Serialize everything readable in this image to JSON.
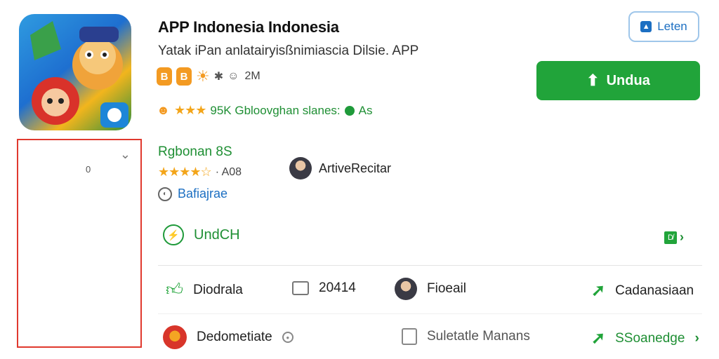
{
  "app": {
    "title": "APP Indonesia Indonesia",
    "subtitle": "Yatak iPan anlatairyisßnimiascia Dilsie. APP",
    "badges": [
      "B",
      "B"
    ],
    "badge_glyph": "✱",
    "badge_count": "2M",
    "rating_line_text": "95K Gbloovghan slanes:",
    "rating_line_tail": "As",
    "stars_top": "★★★"
  },
  "buttons": {
    "follow_label": "Leten",
    "download_label": "Undua"
  },
  "side_panel": {
    "tiny_glyph": "0",
    "chevron": "⌄"
  },
  "review": {
    "section_title": "Rgbonan 8S",
    "stars": "★★★★☆",
    "rating_text": "· A08",
    "reviewer_name": "ArtiveRecitar",
    "language": "Bafiajrae"
  },
  "action": {
    "label": "UndCH",
    "tag": "D̸"
  },
  "rows": {
    "row1": [
      {
        "label": "Diodrala",
        "icon": "thumbs-up-icon"
      },
      {
        "label": "20414",
        "icon": "comment-icon"
      },
      {
        "label": "Fioeail",
        "icon": "avatar"
      },
      {
        "label": "Cadanasiaan",
        "icon": "share-icon"
      }
    ],
    "row2": [
      {
        "label": "Dedometiate",
        "icon": "gift-icon"
      },
      {
        "label": "Suletatle Manans",
        "icon": "document-icon"
      },
      {
        "label": "SSoanedge",
        "icon": "share-icon"
      }
    ]
  },
  "colors": {
    "accent_green": "#21a43a",
    "accent_blue": "#1c6fc2",
    "highlight_red": "#e0392e",
    "star_orange": "#f3a51a"
  }
}
